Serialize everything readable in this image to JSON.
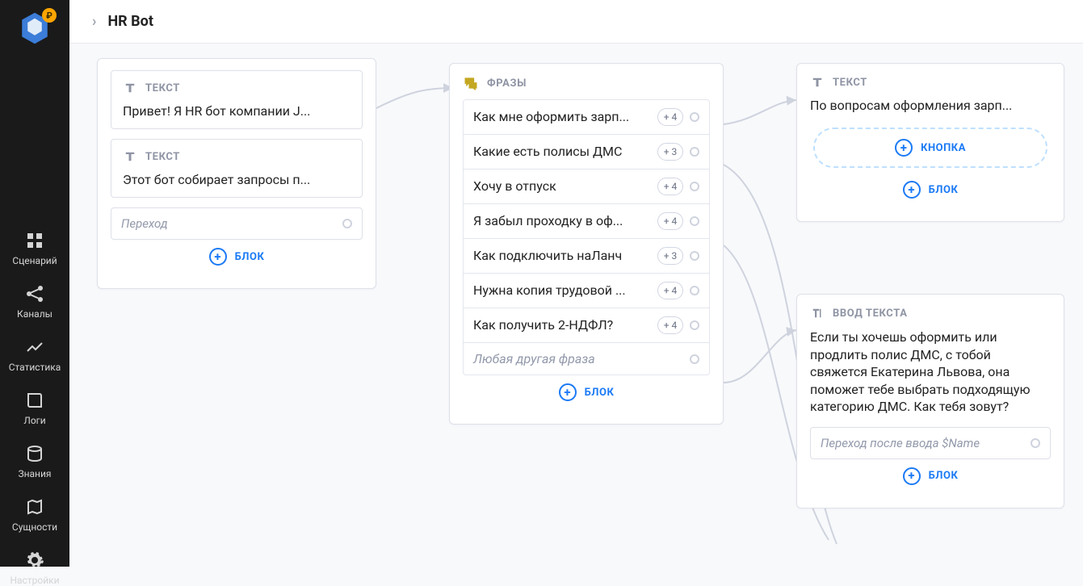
{
  "header": {
    "title": "HR Bot"
  },
  "sidebar": {
    "items": [
      {
        "label": "Сценарий"
      },
      {
        "label": "Каналы"
      },
      {
        "label": "Статистика"
      },
      {
        "label": "Логи"
      },
      {
        "label": "Знания"
      },
      {
        "label": "Сущности"
      },
      {
        "label": "Настройки"
      }
    ],
    "logo_badge": "₽"
  },
  "labels": {
    "text": "ТЕКСТ",
    "phrases": "ФРАЗЫ",
    "text_input": "ВВОД ТЕКСТА",
    "block": "БЛОК",
    "button": "КНОПКА"
  },
  "card1": {
    "b1_body": "Привет! Я HR бот компании J...",
    "b2_body": "Этот бот собирает запросы п...",
    "transition": "Переход"
  },
  "card2": {
    "phrases": [
      {
        "text": "Как мне оформить зарп...",
        "badge": "+ 4"
      },
      {
        "text": "Какие есть полисы ДМС",
        "badge": "+ 3"
      },
      {
        "text": "Хочу в отпуск",
        "badge": "+ 4"
      },
      {
        "text": "Я забыл проходку в оф...",
        "badge": "+ 4"
      },
      {
        "text": "Как подключить наЛанч",
        "badge": "+ 3"
      },
      {
        "text": "Нужна копия трудовой ...",
        "badge": "+ 4"
      },
      {
        "text": "Как получить 2-НДФЛ?",
        "badge": "+ 4"
      }
    ],
    "fallback": "Любая другая фраза"
  },
  "card3": {
    "body": "По вопросам оформления зарп..."
  },
  "card4": {
    "body": "Если ты хочешь оформить или продлить полис ДМС, с тобой свяжется Екатерина Львова, она поможет тебе выбрать подходящую категорию ДМС. Как тебя зовут?",
    "transition": "Переход после ввода $Name"
  }
}
